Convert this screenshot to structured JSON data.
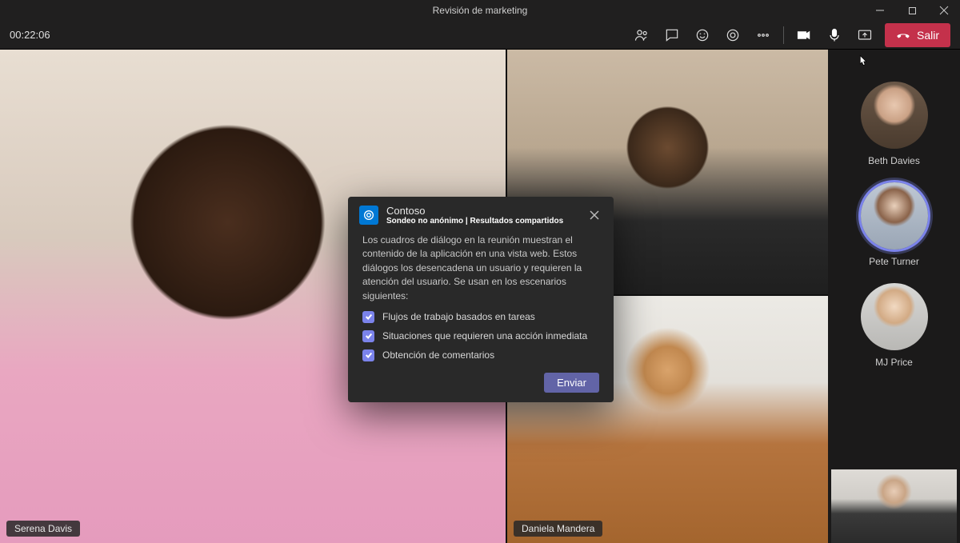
{
  "window": {
    "title": "Revisión de marketing"
  },
  "meeting": {
    "timer": "00:22:06"
  },
  "toolbar": {
    "leave_label": "Salir"
  },
  "tiles": {
    "main": {
      "name": "Serena Davis"
    },
    "topRight": {
      "name": ""
    },
    "bottomRight": {
      "name": "Daniela Mandera"
    }
  },
  "roster": {
    "p1": {
      "name": "Beth Davies"
    },
    "p2": {
      "name": "Pete Turner"
    },
    "p3": {
      "name": "MJ Price"
    }
  },
  "dialog": {
    "app_name": "Contoso",
    "subtitle": "Sondeo no anónimo | Resultados compartidos",
    "body": "Los cuadros de diálogo en la reunión muestran el contenido de la aplicación en una vista web. Estos diálogos los desencadena un usuario y requieren la atención del usuario. Se usan en los escenarios siguientes:",
    "check1": "Flujos de trabajo basados en tareas",
    "check2": "Situaciones que requieren una acción inmediata",
    "check3": "Obtención de comentarios",
    "send_label": "Enviar"
  }
}
